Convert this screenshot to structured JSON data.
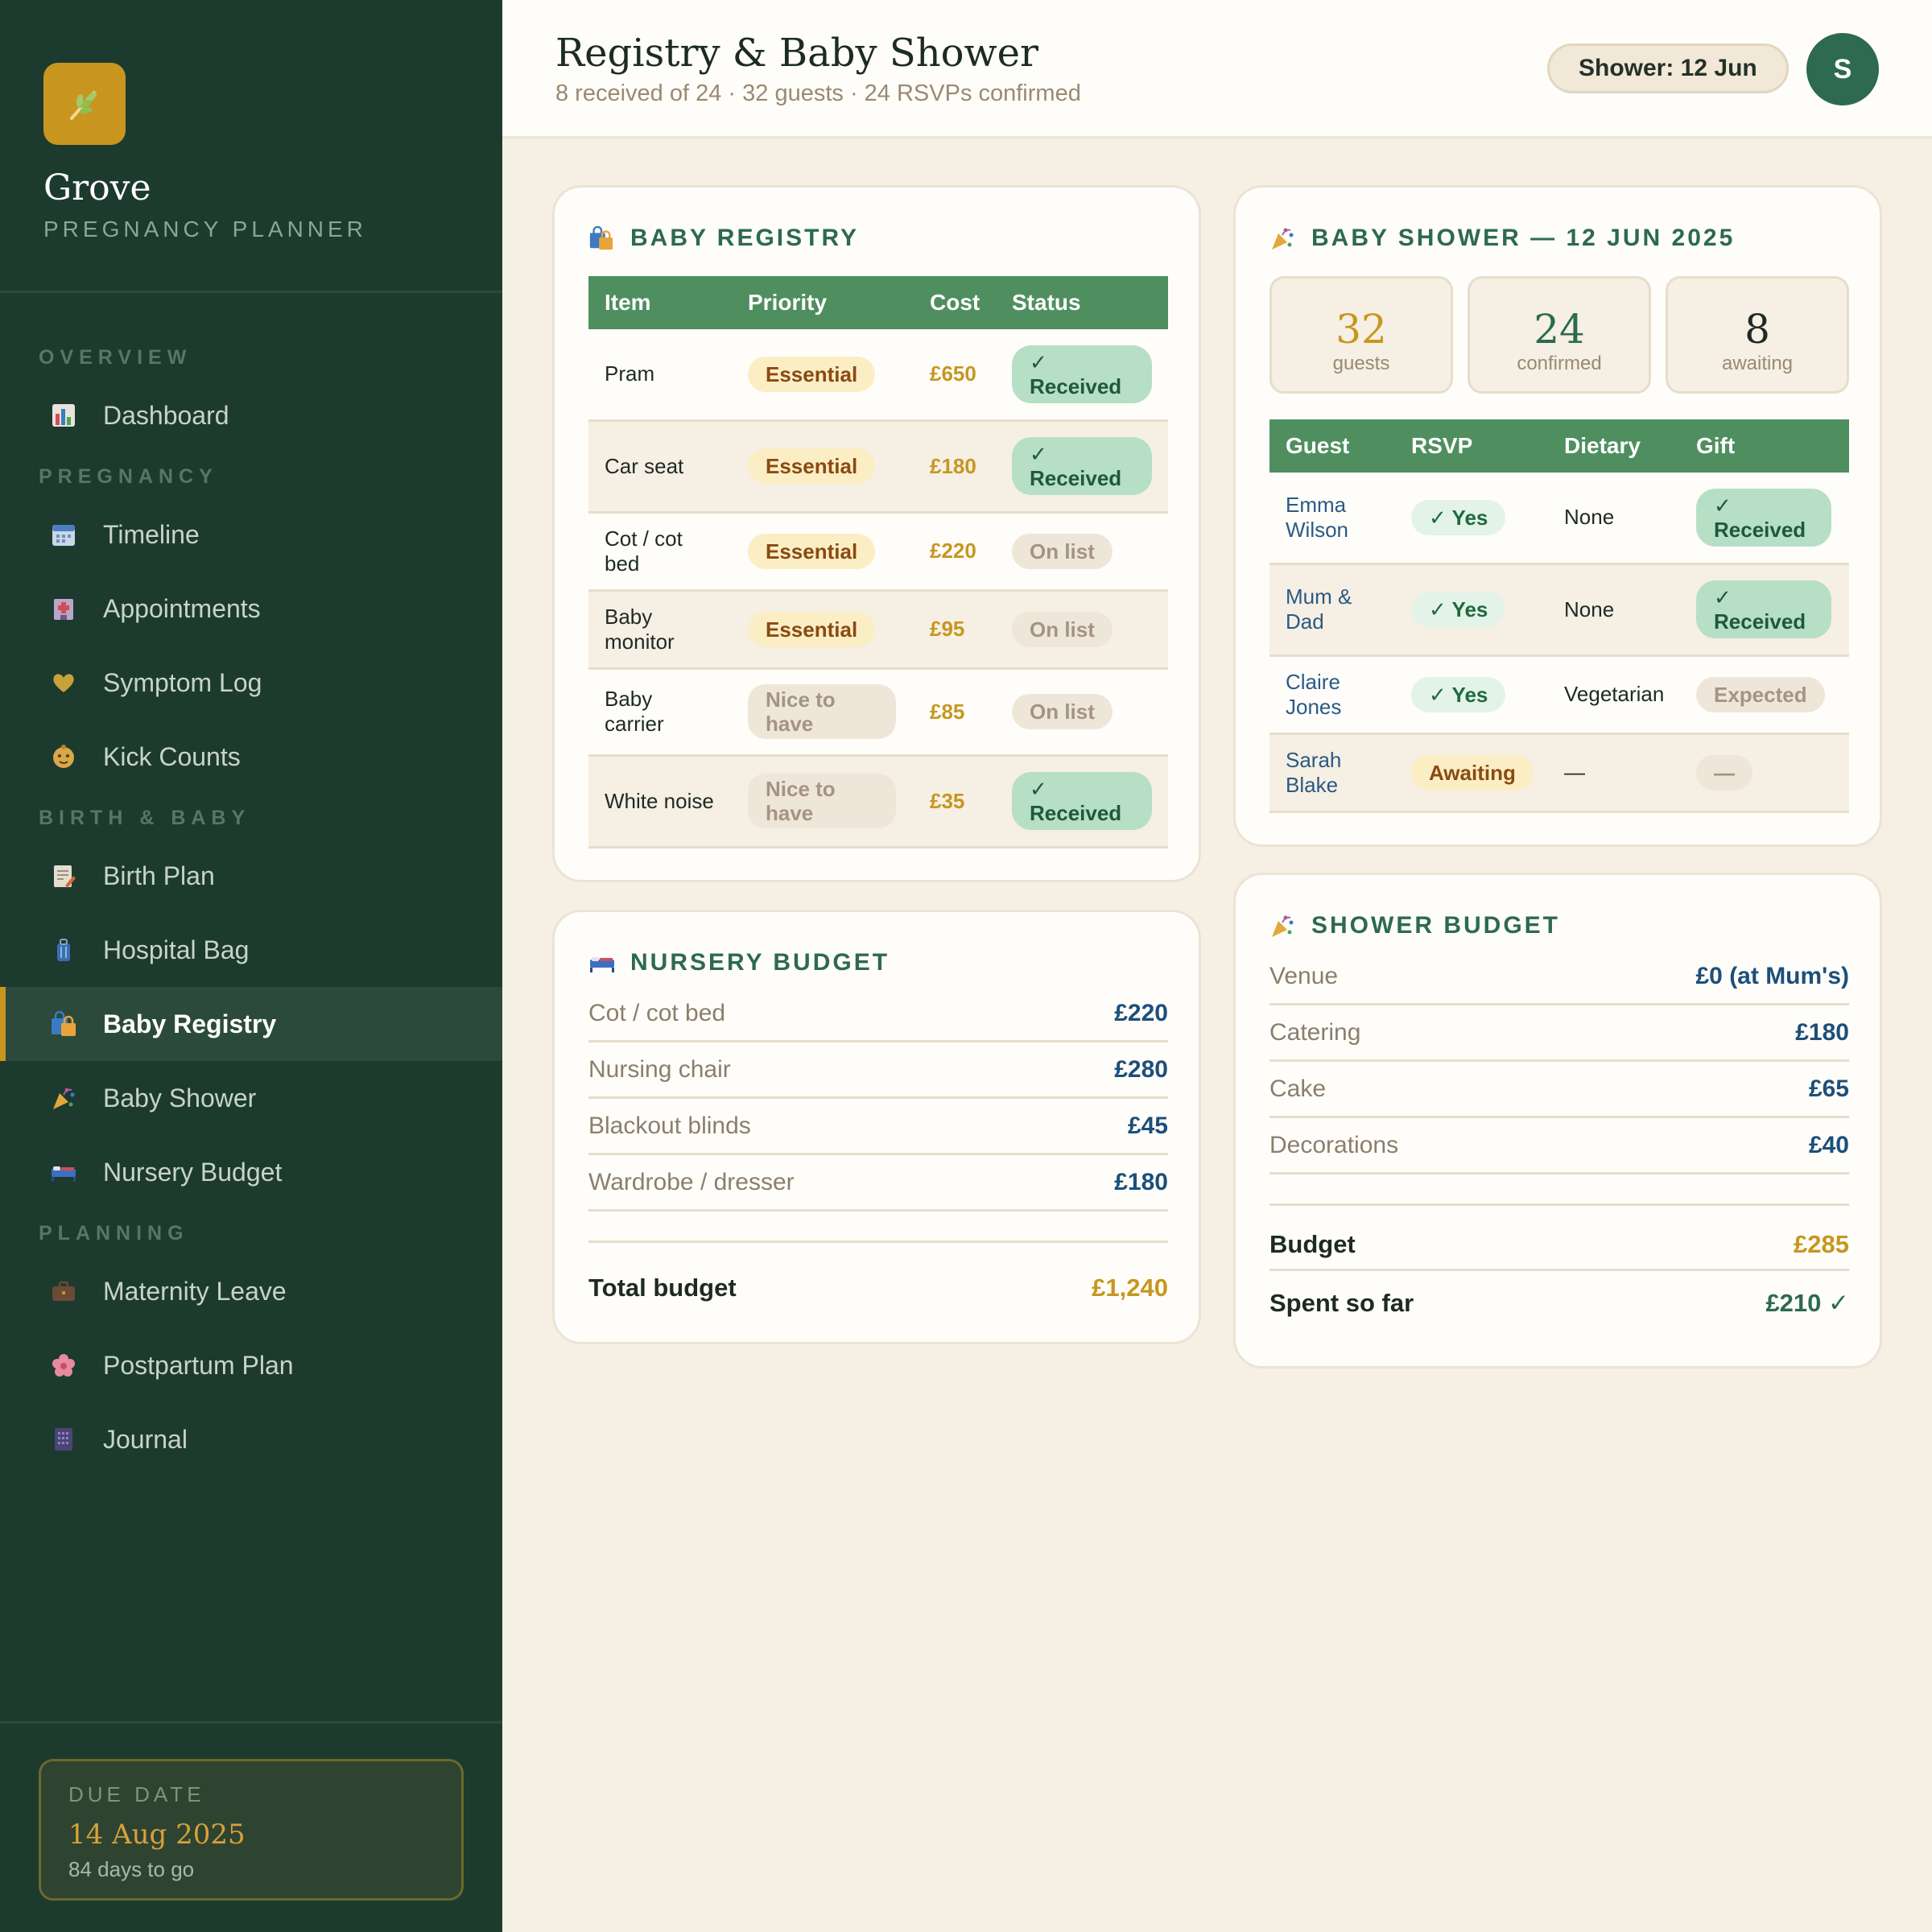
{
  "brand": {
    "name": "Grove",
    "subtitle": "PREGNANCY PLANNER"
  },
  "nav": {
    "sections": {
      "overview": "OVERVIEW",
      "pregnancy": "PREGNANCY",
      "birth_baby": "BIRTH & BABY",
      "planning": "PLANNING"
    },
    "items": {
      "dashboard": "Dashboard",
      "timeline": "Timeline",
      "appointments": "Appointments",
      "symptom_log": "Symptom Log",
      "kick_counts": "Kick Counts",
      "birth_plan": "Birth Plan",
      "hospital_bag": "Hospital Bag",
      "baby_registry": "Baby Registry",
      "baby_shower": "Baby Shower",
      "nursery_budget": "Nursery Budget",
      "maternity_leave": "Maternity Leave",
      "postpartum_plan": "Postpartum Plan",
      "journal": "Journal"
    },
    "active": "baby_registry"
  },
  "due": {
    "label": "DUE DATE",
    "date": "14 Aug 2025",
    "remaining": "84 days to go"
  },
  "header": {
    "title": "Registry & Baby Shower",
    "subtitle": "8 received of 24 · 32 guests · 24 RSVPs confirmed",
    "shower_pill": "Shower: 12 Jun",
    "avatar": "S"
  },
  "registry": {
    "title": "BABY REGISTRY",
    "columns": [
      "Item",
      "Priority",
      "Cost",
      "Status"
    ],
    "rows": [
      {
        "item": "Pram",
        "priority": "Essential",
        "cost": "£650",
        "status": "✓ Received"
      },
      {
        "item": "Car seat",
        "priority": "Essential",
        "cost": "£180",
        "status": "✓ Received"
      },
      {
        "item": "Cot / cot bed",
        "priority": "Essential",
        "cost": "£220",
        "status": "On list"
      },
      {
        "item": "Baby monitor",
        "priority": "Essential",
        "cost": "£95",
        "status": "On list"
      },
      {
        "item": "Baby carrier",
        "priority": "Nice to have",
        "cost": "£85",
        "status": "On list"
      },
      {
        "item": "White noise",
        "priority": "Nice to have",
        "cost": "£35",
        "status": "✓ Received"
      }
    ]
  },
  "shower": {
    "title": "BABY SHOWER — 12 JUN 2025",
    "stats": [
      {
        "value": "32",
        "label": "guests",
        "color": "#c8961f"
      },
      {
        "value": "24",
        "label": "confirmed",
        "color": "#2d6a4f"
      },
      {
        "value": "8",
        "label": "awaiting",
        "color": "#1f2a25"
      }
    ],
    "columns": [
      "Guest",
      "RSVP",
      "Dietary",
      "Gift"
    ],
    "rows": [
      {
        "guest": "Emma Wilson",
        "rsvp": "✓ Yes",
        "dietary": "None",
        "gift": "✓ Received"
      },
      {
        "guest": "Mum & Dad",
        "rsvp": "✓ Yes",
        "dietary": "None",
        "gift": "✓ Received"
      },
      {
        "guest": "Claire Jones",
        "rsvp": "✓ Yes",
        "dietary": "Vegetarian",
        "gift": "Expected"
      },
      {
        "guest": "Sarah Blake",
        "rsvp": "Awaiting",
        "dietary": "—",
        "gift": "—"
      }
    ]
  },
  "nursery": {
    "title": "NURSERY BUDGET",
    "rows": [
      {
        "label": "Cot / cot bed",
        "value": "£220"
      },
      {
        "label": "Nursing chair",
        "value": "£280"
      },
      {
        "label": "Blackout blinds",
        "value": "£45"
      },
      {
        "label": "Wardrobe / dresser",
        "value": "£180"
      }
    ],
    "total_label": "Total budget",
    "total_value": "£1,240"
  },
  "shower_budget": {
    "title": "SHOWER BUDGET",
    "rows": [
      {
        "label": "Venue",
        "value": "£0 (at Mum's)"
      },
      {
        "label": "Catering",
        "value": "£180"
      },
      {
        "label": "Cake",
        "value": "£65"
      },
      {
        "label": "Decorations",
        "value": "£40"
      }
    ],
    "budget_label": "Budget",
    "budget_value": "£285",
    "spent_label": "Spent so far",
    "spent_value": "£210 ✓"
  }
}
